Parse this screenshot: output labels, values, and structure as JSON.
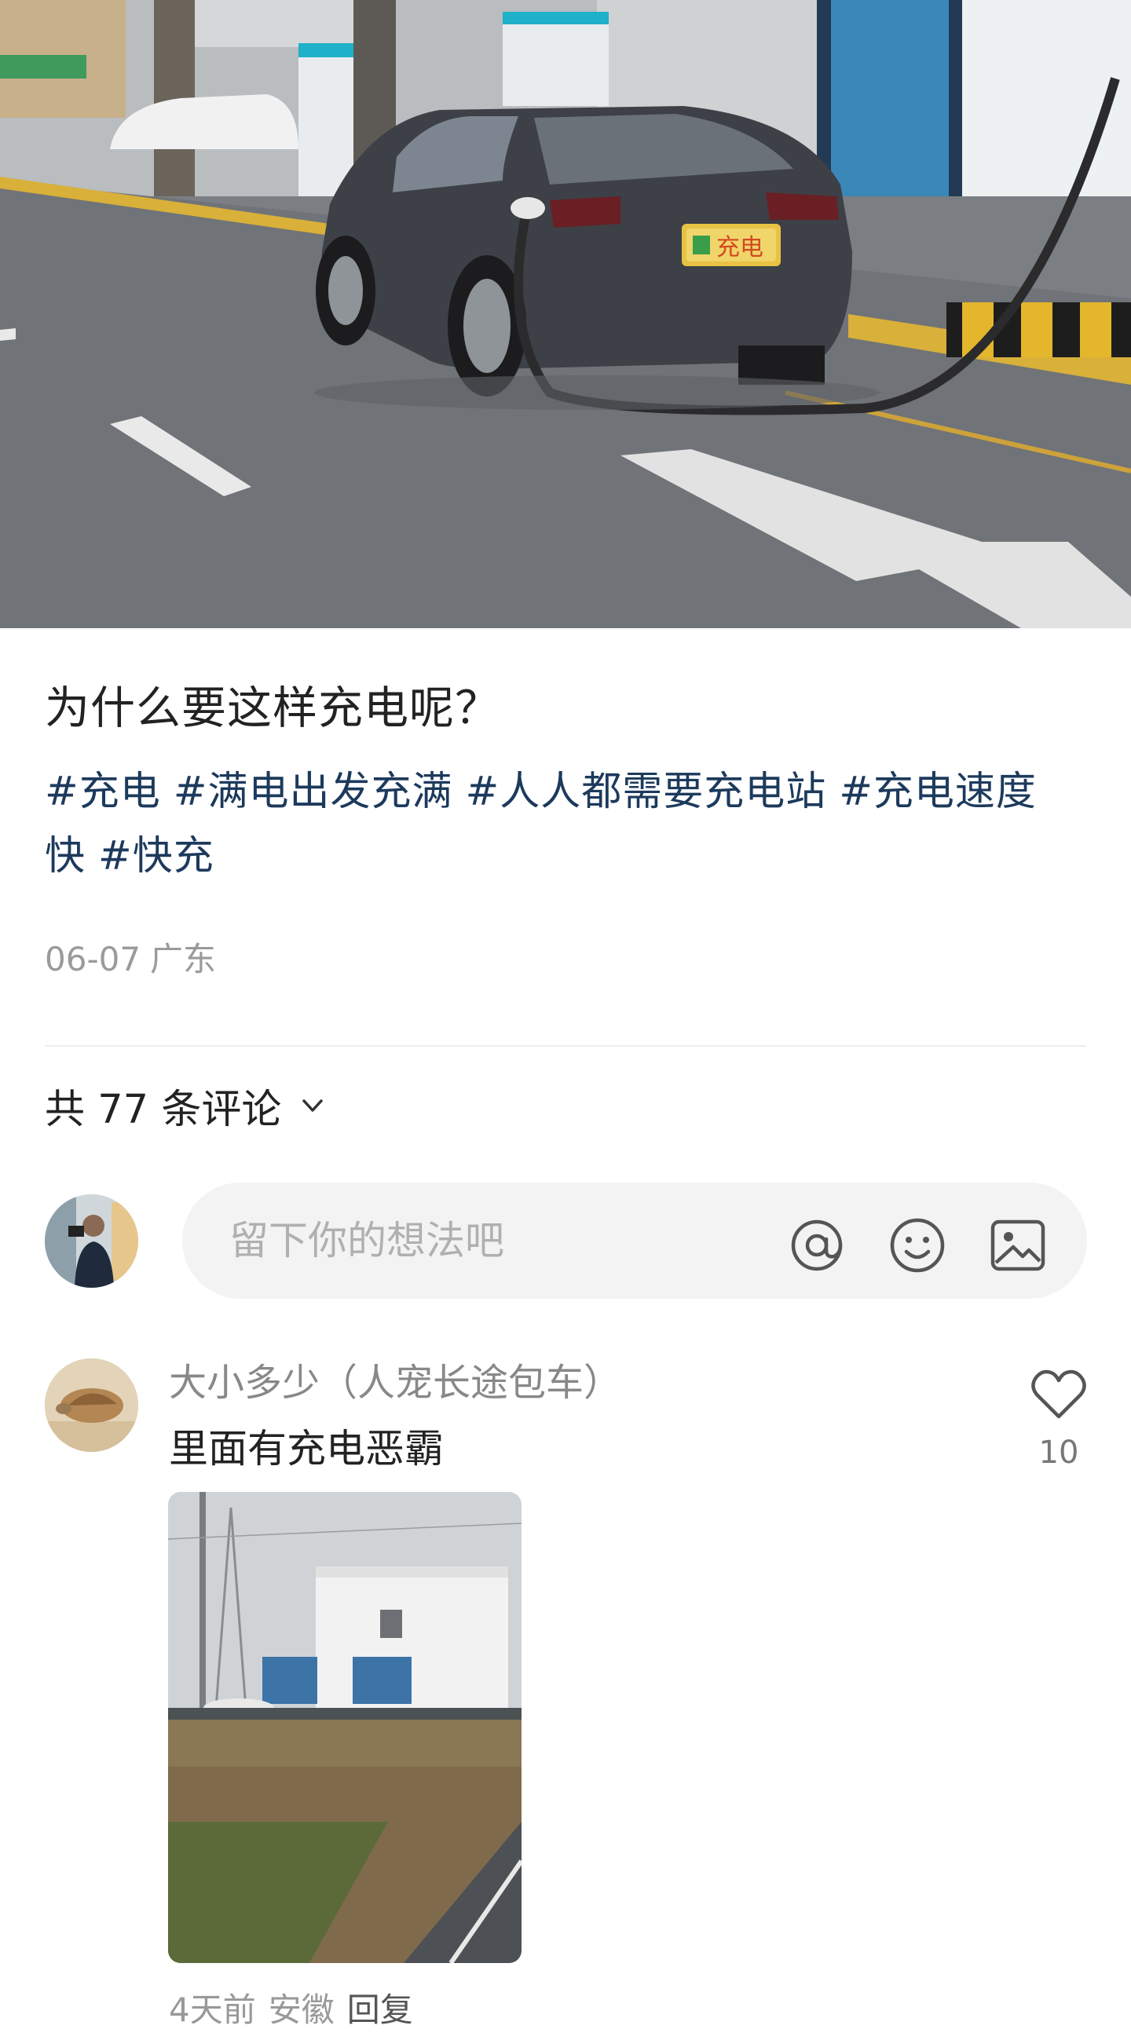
{
  "post": {
    "title": "为什么要这样充电呢？",
    "tags": [
      "#充电",
      "#满电出发充满",
      "#人人都需要充电站",
      "#充电速度快",
      "#快充"
    ],
    "date": "06-07",
    "location": "广东",
    "hero_plate_text": "充电"
  },
  "comments_header": {
    "label": "共 77 条评论",
    "chevron_icon": "chevron-down-icon"
  },
  "composer": {
    "placeholder": "留下你的想法吧",
    "icons": [
      "at-icon",
      "emoji-icon",
      "image-icon"
    ]
  },
  "comments": [
    {
      "user": "大小多少（人宠长途包车）",
      "text": "里面有充电恶霸",
      "likes": "10",
      "time": "4天前",
      "location": "安徽",
      "reply_label": "回复"
    }
  ],
  "colors": {
    "tag": "#1c3a5c",
    "meta": "#9a9a9a",
    "composer_bg": "#f3f3f3"
  }
}
